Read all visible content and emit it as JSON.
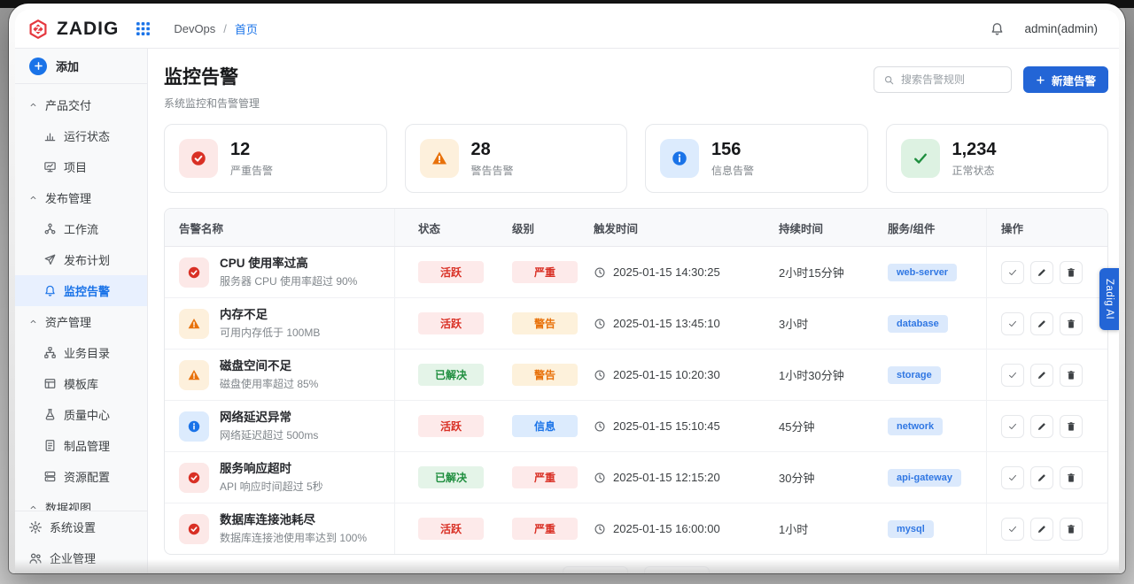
{
  "header": {
    "brand": "ZADIG",
    "breadcrumb": {
      "app": "DevOps",
      "separator": "/",
      "current": "首页"
    },
    "user": "admin(admin)"
  },
  "sidebar": {
    "add_label": "添加",
    "groups": [
      {
        "label": "产品交付",
        "items": [
          {
            "label": "运行状态",
            "icon": "bar-chart"
          },
          {
            "label": "项目",
            "icon": "presentation"
          }
        ]
      },
      {
        "label": "发布管理",
        "items": [
          {
            "label": "工作流",
            "icon": "workflow"
          },
          {
            "label": "发布计划",
            "icon": "send"
          },
          {
            "label": "监控告警",
            "icon": "bell",
            "active": true
          }
        ]
      },
      {
        "label": "资产管理",
        "items": [
          {
            "label": "业务目录",
            "icon": "org"
          },
          {
            "label": "模板库",
            "icon": "template"
          },
          {
            "label": "质量中心",
            "icon": "flask"
          },
          {
            "label": "制品管理",
            "icon": "doc"
          },
          {
            "label": "资源配置",
            "icon": "server"
          }
        ]
      },
      {
        "label": "数据视图",
        "items": []
      }
    ],
    "footer_items": [
      {
        "label": "系统设置",
        "icon": "gear"
      },
      {
        "label": "企业管理",
        "icon": "people"
      }
    ]
  },
  "page": {
    "title": "监控告警",
    "subtitle": "系统监控和告警管理",
    "search_placeholder": "搜索告警规则",
    "create_label": "新建告警"
  },
  "stats": [
    {
      "value": "12",
      "label": "严重告警",
      "type": "critical"
    },
    {
      "value": "28",
      "label": "警告告警",
      "type": "warning"
    },
    {
      "value": "156",
      "label": "信息告警",
      "type": "info"
    },
    {
      "value": "1,234",
      "label": "正常状态",
      "type": "success"
    }
  ],
  "table": {
    "columns": [
      "告警名称",
      "状态",
      "级别",
      "触发时间",
      "持续时间",
      "服务/组件",
      "操作"
    ],
    "rows": [
      {
        "name": "CPU 使用率过高",
        "desc": "服务器 CPU 使用率超过 90%",
        "severity": "critical",
        "status": "活跃",
        "status_type": "active",
        "level": "严重",
        "level_type": "critical",
        "time": "2025-01-15 14:30:25",
        "duration": "2小时15分钟",
        "service": "web-server"
      },
      {
        "name": "内存不足",
        "desc": "可用内存低于 100MB",
        "severity": "warning",
        "status": "活跃",
        "status_type": "active",
        "level": "警告",
        "level_type": "warning",
        "time": "2025-01-15 13:45:10",
        "duration": "3小时",
        "service": "database"
      },
      {
        "name": "磁盘空间不足",
        "desc": "磁盘使用率超过 85%",
        "severity": "warning",
        "status": "已解决",
        "status_type": "resolved",
        "level": "警告",
        "level_type": "warning",
        "time": "2025-01-15 10:20:30",
        "duration": "1小时30分钟",
        "service": "storage"
      },
      {
        "name": "网络延迟异常",
        "desc": "网络延迟超过 500ms",
        "severity": "info",
        "status": "活跃",
        "status_type": "active",
        "level": "信息",
        "level_type": "info",
        "time": "2025-01-15 15:10:45",
        "duration": "45分钟",
        "service": "network"
      },
      {
        "name": "服务响应超时",
        "desc": "API 响应时间超过 5秒",
        "severity": "critical",
        "status": "已解决",
        "status_type": "resolved",
        "level": "严重",
        "level_type": "critical",
        "time": "2025-01-15 12:15:20",
        "duration": "30分钟",
        "service": "api-gateway"
      },
      {
        "name": "数据库连接池耗尽",
        "desc": "数据库连接池使用率达到 100%",
        "severity": "critical",
        "status": "活跃",
        "status_type": "active",
        "level": "严重",
        "level_type": "critical",
        "time": "2025-01-15 16:00:00",
        "duration": "1小时",
        "service": "mysql"
      }
    ]
  },
  "ai_tab": {
    "label": "Zadig AI"
  },
  "colors": {
    "accent_blue": "#1a73e8",
    "button_blue": "#2365d6",
    "critical_red": "#d93025",
    "warning_orange": "#e8710a",
    "info_blue": "#1a73e8",
    "success_green": "#1e8e3e",
    "sidebar_active_bg": "#e8f0fe"
  }
}
